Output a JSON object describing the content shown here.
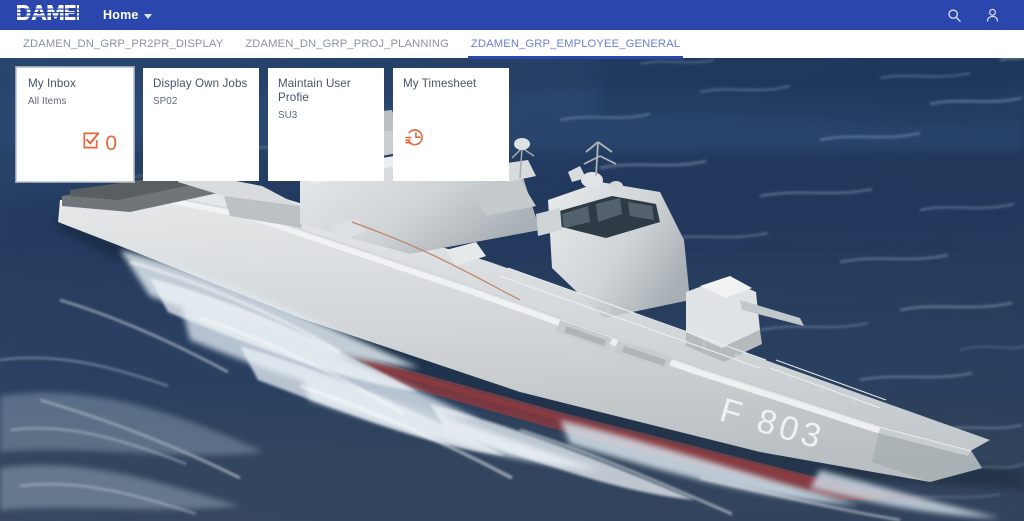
{
  "shellbar": {
    "logo_text": "DAMEN",
    "logo_name": "damen-logo",
    "menu_label": "Home",
    "caret_icon": "chevron-down-icon",
    "search_icon": "search-icon",
    "user_icon": "user-avatar-icon",
    "background_color": "#2b47ae",
    "text_color": "#ffffff"
  },
  "tabs": {
    "items": [
      {
        "label": "ZDAMEN_DN_GRP_PR2PR_DISPLAY",
        "active": false
      },
      {
        "label": "ZDAMEN_DN_GRP_PROJ_PLANNING",
        "active": false
      },
      {
        "label": "ZDAMEN_GRP_EMPLOYEE_GENERAL",
        "active": true
      }
    ],
    "active_color": "#6b7fd7",
    "inactive_color": "#8b93a3",
    "underline_color": "#2b47ae"
  },
  "tiles": {
    "accent_color": "#e8663a",
    "title_color": "#44546b",
    "items": [
      {
        "title": "My Inbox",
        "subtitle": "All Items",
        "count": "0",
        "icon": "checkbox-checked-icon",
        "icon_align": "right",
        "focused": true
      },
      {
        "title": "Display Own Jobs",
        "subtitle": "SP02",
        "count": "",
        "icon": "",
        "icon_align": "left",
        "focused": false
      },
      {
        "title": "Maintain User Profie",
        "subtitle": "SU3",
        "count": "",
        "icon": "",
        "icon_align": "left",
        "focused": false
      },
      {
        "title": "My Timesheet",
        "subtitle": "",
        "count": "",
        "icon": "clock-history-icon",
        "icon_align": "left",
        "focused": false
      }
    ]
  },
  "background": {
    "name": "naval-frigate-at-sea-photo",
    "hull_number": "F 803",
    "sea_color_dark": "#1b2c4a",
    "sea_color_mid": "#2b4368",
    "ship_color": "#d8dbdd"
  }
}
